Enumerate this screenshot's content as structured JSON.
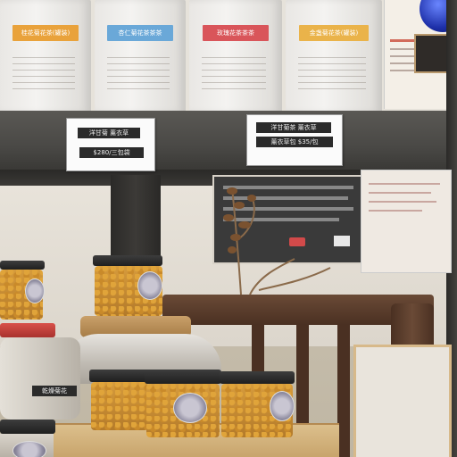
{
  "colors": {
    "shelf": "#4a4946",
    "wall": "#d9d2c4",
    "tray": "#d8b37a",
    "chair": "#5a3b2a",
    "flowers": "#d69b3c",
    "label_orange": "#e9a23b",
    "label_blue": "#6aa8d8",
    "label_red": "#d9555a",
    "label_yellow": "#eab34a"
  },
  "boxes": [
    {
      "label": "桂花菊花茶(罐装)",
      "color": "#e9a23b"
    },
    {
      "label": "杏仁菊花茶茶茶",
      "color": "#6aa8d8"
    },
    {
      "label": "玫瑰花茶茶茶",
      "color": "#d9555a"
    },
    {
      "label": "金盏菊花茶(罐装)",
      "color": "#eab34a"
    }
  ],
  "price_cards": {
    "left": {
      "line1": "洋甘菊 薰衣草",
      "line2": "$280/三包袋"
    },
    "right": {
      "line1": "洋甘菊茶 薰衣草",
      "line2": "薰衣草包 $35/包"
    }
  },
  "jar_labels": {
    "tall_jar": "乾燥菊花"
  },
  "icons": [
    "blue-ornament",
    "dried-flower-branch",
    "stool-icon"
  ]
}
